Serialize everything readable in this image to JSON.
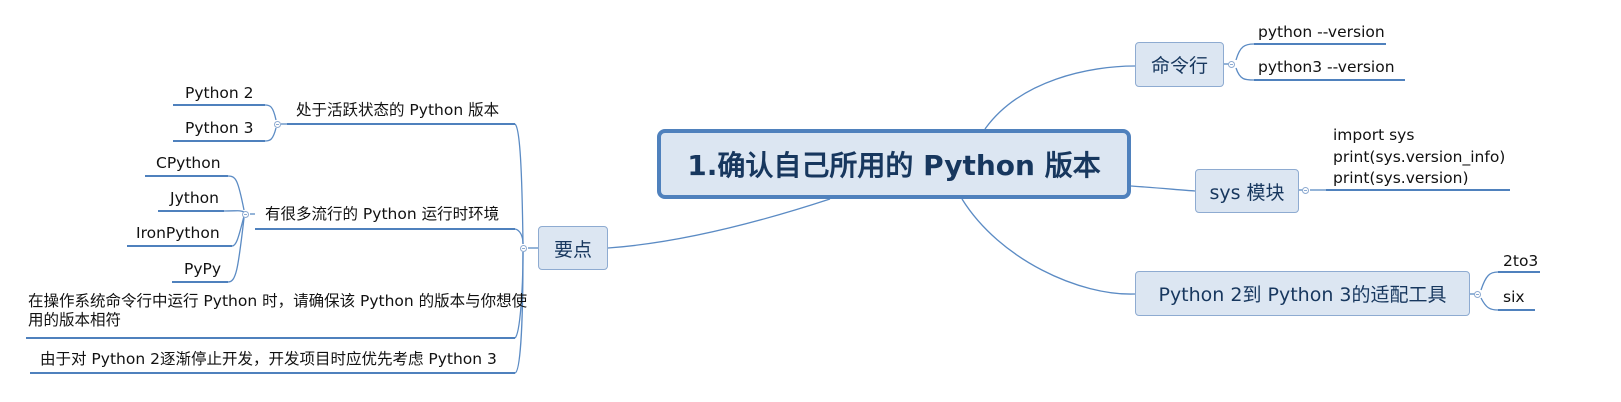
{
  "central": {
    "title": "1.确认自己所用的 Python 版本"
  },
  "branches": {
    "cmd": {
      "label": "命令行",
      "items": [
        "python --version",
        "python3 --version"
      ]
    },
    "sys": {
      "label": "sys 模块",
      "code": [
        "import sys",
        "print(sys.version_info)",
        "print(sys.version)"
      ]
    },
    "tools": {
      "label": "Python 2到 Python 3的适配工具",
      "items": [
        "2to3",
        "six"
      ]
    },
    "keypoints": {
      "label": "要点",
      "active": {
        "label": "处于活跃状态的 Python 版本",
        "items": [
          "Python 2",
          "Python 3"
        ]
      },
      "runtimes": {
        "label": "有很多流行的 Python 运行时环境",
        "items": [
          "CPython",
          "Jython",
          "IronPython",
          "PyPy"
        ]
      },
      "tip": "在操作系统命令行中运行 Python 时，请确保该 Python 的版本与你想使用的版本相符",
      "advice": "由于对 Python 2逐渐停止开发，开发项目时应优先考虑 Python 3"
    }
  },
  "colors": {
    "line": "#5b8bc4",
    "underline": "#4f81bd",
    "node_fill": "#dce6f2",
    "central_border": "#4f81bd"
  }
}
